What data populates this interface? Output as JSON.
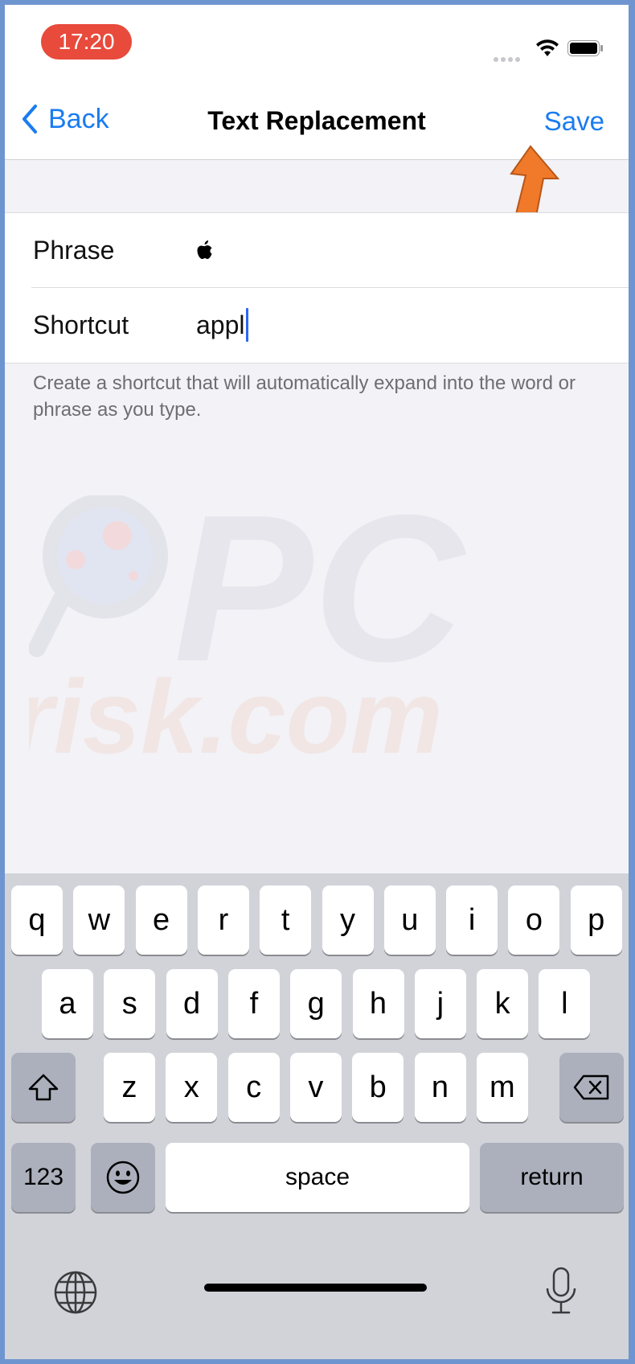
{
  "status": {
    "time": "17:20"
  },
  "nav": {
    "back_label": "Back",
    "title": "Text Replacement",
    "save_label": "Save"
  },
  "form": {
    "phrase_label": "Phrase",
    "phrase_value": "",
    "shortcut_label": "Shortcut",
    "shortcut_value": "appl",
    "hint": "Create a shortcut that will automatically expand into the word or phrase as you type."
  },
  "watermark": {
    "text_top": "PC",
    "text_bottom": "risk.com"
  },
  "keyboard": {
    "row1": [
      "q",
      "w",
      "e",
      "r",
      "t",
      "y",
      "u",
      "i",
      "o",
      "p"
    ],
    "row2": [
      "a",
      "s",
      "d",
      "f",
      "g",
      "h",
      "j",
      "k",
      "l"
    ],
    "row3": [
      "z",
      "x",
      "c",
      "v",
      "b",
      "n",
      "m"
    ],
    "numbers_label": "123",
    "space_label": "space",
    "return_label": "return"
  },
  "colors": {
    "accent": "#1a7cf0",
    "annotation_arrow": "#f07a2a",
    "status_pill": "#e84a3b"
  },
  "icons": {
    "back": "chevron-left-icon",
    "phrase_value": "apple-logo-icon",
    "globe": "globe-icon",
    "mic": "microphone-icon"
  }
}
